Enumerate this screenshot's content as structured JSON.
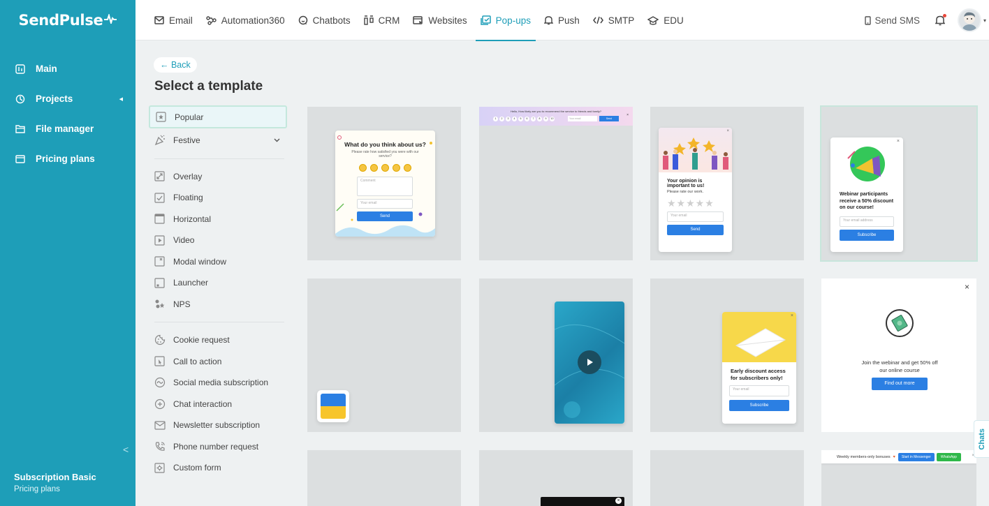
{
  "logo": "SendPulse",
  "nav": [
    {
      "label": "Email",
      "icon": "mail-icon"
    },
    {
      "label": "Automation360",
      "icon": "automation-icon"
    },
    {
      "label": "Chatbots",
      "icon": "chatbot-icon"
    },
    {
      "label": "CRM",
      "icon": "crm-icon"
    },
    {
      "label": "Websites",
      "icon": "websites-icon"
    },
    {
      "label": "Pop-ups",
      "icon": "popups-icon",
      "active": true
    },
    {
      "label": "Push",
      "icon": "bell-icon"
    },
    {
      "label": "SMTP",
      "icon": "code-icon"
    },
    {
      "label": "EDU",
      "icon": "graduation-icon"
    }
  ],
  "top_right": {
    "send_sms": "Send SMS"
  },
  "sidebar": {
    "items": [
      {
        "label": "Main",
        "icon": "dashboard-icon"
      },
      {
        "label": "Projects",
        "icon": "projects-icon"
      },
      {
        "label": "File manager",
        "icon": "folder-icon"
      },
      {
        "label": "Pricing plans",
        "icon": "wallet-icon"
      }
    ],
    "plan": "Subscription Basic",
    "plan_link": "Pricing plans"
  },
  "main": {
    "back": "← Back",
    "title": "Select a template"
  },
  "categories": {
    "group1": [
      {
        "label": "Popular",
        "icon": "star-icon"
      },
      {
        "label": "Festive",
        "icon": "festive-icon"
      }
    ],
    "group2": [
      {
        "label": "Overlay",
        "icon": "overlay-icon"
      },
      {
        "label": "Floating",
        "icon": "floating-icon"
      },
      {
        "label": "Horizontal",
        "icon": "horizontal-icon"
      },
      {
        "label": "Video",
        "icon": "video-icon"
      },
      {
        "label": "Modal window",
        "icon": "modal-icon"
      },
      {
        "label": "Launcher",
        "icon": "launcher-icon"
      },
      {
        "label": "NPS",
        "icon": "nps-icon"
      }
    ],
    "group3": [
      {
        "label": "Cookie request",
        "icon": "cookie-icon"
      },
      {
        "label": "Call to action",
        "icon": "cta-icon"
      },
      {
        "label": "Social media subscription",
        "icon": "social-icon"
      },
      {
        "label": "Chat interaction",
        "icon": "chat-icon"
      },
      {
        "label": "Newsletter subscription",
        "icon": "newsletter-icon"
      },
      {
        "label": "Phone number request",
        "icon": "phone-icon"
      },
      {
        "label": "Custom form",
        "icon": "custom-form-icon"
      }
    ]
  },
  "templates": {
    "t1": {
      "title": "What do you think about us?",
      "sub": "Please rate how satisfied you were with our service?",
      "comment": "Comment",
      "email": "Your email",
      "button": "Send"
    },
    "t2": {
      "question": "Hello, How likely are you to recommend the service to friends and family?",
      "numbers": [
        "1",
        "2",
        "3",
        "4",
        "5",
        "6",
        "7",
        "8",
        "9",
        "10"
      ],
      "email": "Your email",
      "button": "Send"
    },
    "t3": {
      "title": "Your opinion is important to us!",
      "sub": "Please rate our work.",
      "email": "Your email",
      "button": "Send"
    },
    "t4": {
      "title": "Webinar participants receive a 50% discount on our course!",
      "email": "Your email address",
      "button": "Subscribe"
    },
    "t7": {
      "title": "Early discount access for subscribers only!",
      "email": "Your email",
      "button": "Subscribe"
    },
    "t8": {
      "text": "Join the webinar and get 50% off our online course",
      "button": "Find out more"
    },
    "t12": {
      "text": "Weekly members-only bonuses",
      "btn1": "Start in Messenger",
      "btn2": "WhatsApp"
    }
  },
  "chats_label": "Chats",
  "colors": {
    "brand": "#1e9eb8",
    "button_blue": "#2b7fe3"
  }
}
